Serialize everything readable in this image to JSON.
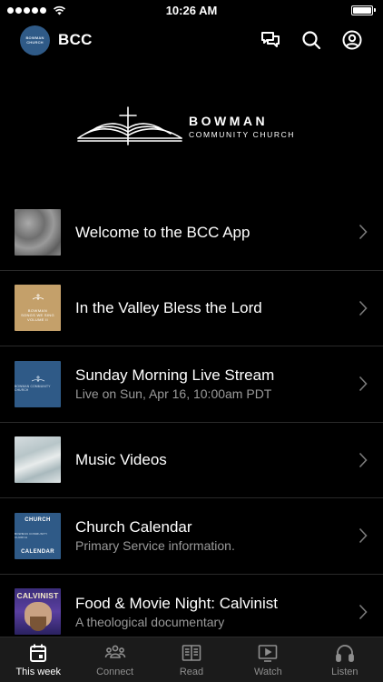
{
  "status_bar": {
    "time": "10:26 AM"
  },
  "header": {
    "title": "BCC",
    "avatar_text": "BOWMAN CHURCH"
  },
  "logo": {
    "line1": "BOWMAN",
    "line2": "COMMUNITY CHURCH"
  },
  "feed": [
    {
      "title": "Welcome to the BCC App",
      "subtitle": ""
    },
    {
      "title": "In the Valley Bless the Lord",
      "subtitle": "",
      "thumb_line1": "BOWMAN",
      "thumb_line2": "SONGS WE SING",
      "thumb_line3": "VOLUME II"
    },
    {
      "title": "Sunday Morning Live Stream",
      "subtitle": "Live on Sun, Apr 16, 10:00am PDT",
      "thumb_line1": "BOWMAN COMMUNITY CHURCH"
    },
    {
      "title": "Music Videos",
      "subtitle": ""
    },
    {
      "title": "Church Calendar",
      "subtitle": "Primary Service information.",
      "thumb_line1": "CHURCH",
      "thumb_line2": "CALENDAR",
      "thumb_line3": "BOWMAN COMMUNITY CHURCH"
    },
    {
      "title": "Food & Movie Night: Calvinist",
      "subtitle": "A theological documentary",
      "thumb_line1": "CALVINIST"
    }
  ],
  "tabs": [
    {
      "label": "This week",
      "icon": "calendar-icon",
      "active": true
    },
    {
      "label": "Connect",
      "icon": "people-icon",
      "active": false
    },
    {
      "label": "Read",
      "icon": "book-icon",
      "active": false
    },
    {
      "label": "Watch",
      "icon": "video-icon",
      "active": false
    },
    {
      "label": "Listen",
      "icon": "headphones-icon",
      "active": false
    }
  ],
  "colors": {
    "background": "#000000",
    "tab_bar": "#1b1b1b",
    "brand_blue": "#2f5a87",
    "subtitle": "#9a9a9a"
  }
}
